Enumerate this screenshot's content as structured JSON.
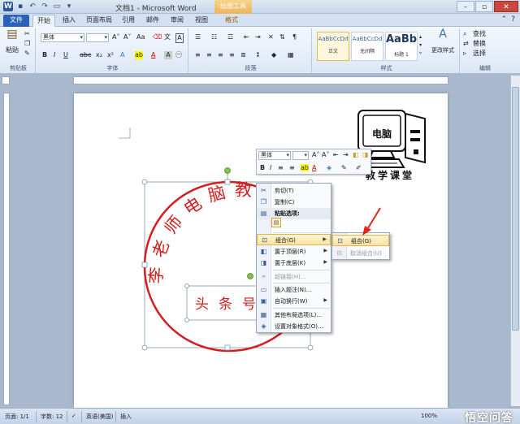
{
  "titlebar": {
    "window_title": "文档1 - Microsoft Word",
    "context_tool": "绘图工具",
    "app_icon": "W"
  },
  "tabs": {
    "file": "文件",
    "items": [
      "开始",
      "插入",
      "页面布局",
      "引用",
      "邮件",
      "审阅",
      "视图",
      "格式"
    ]
  },
  "ribbon": {
    "clipboard": {
      "paste": "粘贴",
      "label": "剪贴板"
    },
    "font": {
      "font_name": "黑体",
      "font_size": "",
      "label": "字体"
    },
    "paragraph": {
      "label": "段落"
    },
    "styles": {
      "label": "样式",
      "items": [
        {
          "sample": "AaBbCcDd",
          "name": "正文"
        },
        {
          "sample": "AaBbCcDd",
          "name": "无间隔"
        },
        {
          "sample": "AaBb",
          "name": "标题 1"
        }
      ],
      "change": "更改样式"
    },
    "editing": {
      "label": "编辑",
      "find": "查找",
      "replace": "替换",
      "select": "选择"
    }
  },
  "document": {
    "logo_monitor": "电脑",
    "logo_caption": "教学课堂",
    "seal_outer": "李老师电脑教",
    "seal_inner": "头条号"
  },
  "minibar": {
    "font_name": "黑体",
    "font_size": ""
  },
  "context_menu": {
    "items": [
      {
        "label": "剪切(T)",
        "icon": "scissors-icon"
      },
      {
        "label": "复制(C)",
        "icon": "copy-icon"
      },
      {
        "label": "粘贴选项:",
        "icon": "paste-icon"
      },
      {
        "label": "组合(G)",
        "icon": "group-icon"
      },
      {
        "label": "置于顶层(R)",
        "icon": "bring-front-icon"
      },
      {
        "label": "置于底层(K)",
        "icon": "send-back-icon"
      },
      {
        "label": "超链接(H)...",
        "icon": "hyperlink-icon"
      },
      {
        "label": "插入题注(N)...",
        "icon": "caption-icon"
      },
      {
        "label": "自动换行(W)",
        "icon": "wrap-icon"
      },
      {
        "label": "其他布局选项(L)...",
        "icon": "layout-icon"
      },
      {
        "label": "设置对象格式(O)...",
        "icon": "format-icon"
      }
    ]
  },
  "submenu": {
    "items": [
      {
        "label": "组合(G)"
      },
      {
        "label": "取消组合(U)"
      }
    ]
  },
  "statusbar": {
    "page": "页面: 1/1",
    "words": "字数: 12",
    "language": "英语(美国)",
    "mode": "插入",
    "zoom": "100%",
    "watermark": "悟空问答"
  },
  "colors": {
    "seal_red": "#d21e1e",
    "accent_blue": "#2a62b8"
  }
}
